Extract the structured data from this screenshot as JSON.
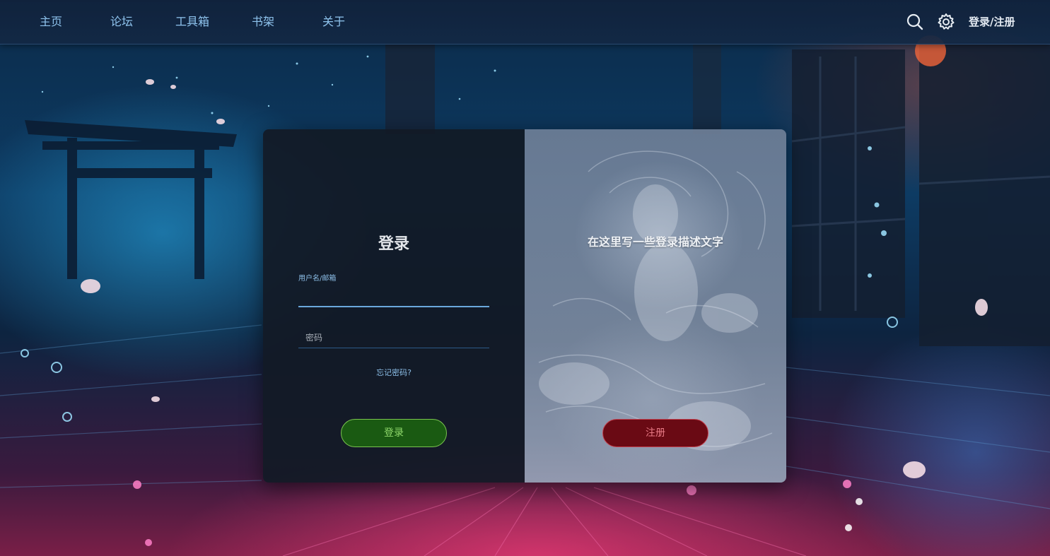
{
  "nav": {
    "items": [
      {
        "label": "主页"
      },
      {
        "label": "论坛"
      },
      {
        "label": "工具箱"
      },
      {
        "label": "书架"
      },
      {
        "label": "关于"
      }
    ],
    "icons": {
      "search": "search-icon",
      "settings": "gear-icon"
    },
    "login_register": "登录/注册"
  },
  "login": {
    "title": "登录",
    "username_label": "用户名/邮箱",
    "username_value": "",
    "password_placeholder": "密码",
    "forgot": "忘记密码?",
    "submit": "登录"
  },
  "register": {
    "description": "在这里写一些登录描述文字",
    "button": "注册"
  },
  "colors": {
    "nav_bg": "#12243c",
    "nav_text": "#8fc4ee",
    "accent_blue": "#6aa8dc",
    "login_green": "#1a5a12",
    "register_red": "#6a0a14"
  }
}
